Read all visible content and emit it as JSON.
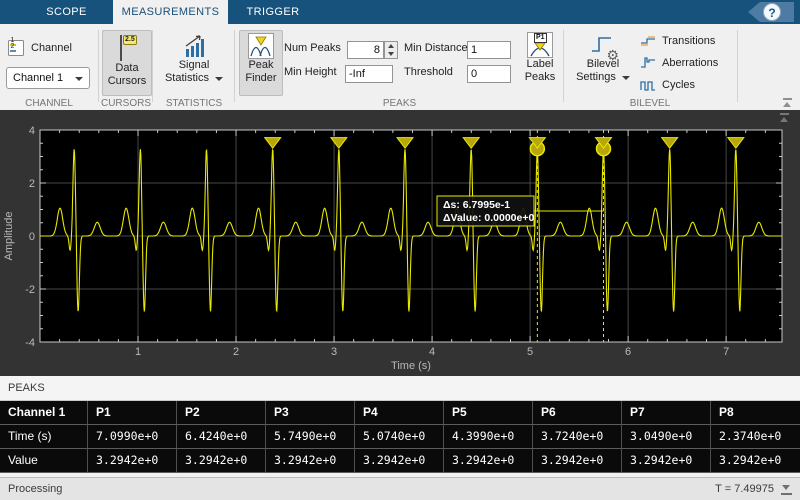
{
  "window": {
    "tabs": [
      {
        "label": "SCOPE"
      },
      {
        "label": "MEASUREMENTS"
      },
      {
        "label": "TRIGGER"
      }
    ],
    "help": "?"
  },
  "ribbon": {
    "channel": {
      "icon_label": "Channel",
      "selected": "Channel 1",
      "digit1": "1",
      "digit2": "2",
      "section": "CHANNEL"
    },
    "cursors": {
      "line1": "Data",
      "line2": "Cursors",
      "badge": "2.5",
      "section": "CURSORS"
    },
    "statistics": {
      "line1": "Signal",
      "line2": "Statistics",
      "section": "STATISTICS"
    },
    "peaks": {
      "finder_line1": "Peak",
      "finder_line2": "Finder",
      "num_peaks_label": "Num Peaks",
      "num_peaks_value": "8",
      "min_distance_label": "Min Distance",
      "min_distance_value": "1",
      "min_height_label": "Min Height",
      "min_height_value": "-Inf",
      "threshold_label": "Threshold",
      "threshold_value": "0",
      "label_line1": "Label",
      "label_line2": "Peaks",
      "p1_badge": "P1",
      "section": "PEAKS"
    },
    "bilevel": {
      "line1": "Bilevel",
      "line2": "Settings",
      "items": [
        {
          "label": "Transitions"
        },
        {
          "label": "Aberrations"
        },
        {
          "label": "Cycles"
        }
      ],
      "section": "BILEVEL"
    },
    "icons": {
      "gear": "⚙"
    }
  },
  "chart_data": {
    "type": "line",
    "title": "",
    "xlabel": "Time (s)",
    "ylabel": "Amplitude",
    "xlim": [
      0,
      7.57
    ],
    "ylim": [
      -4,
      4
    ],
    "xticks": [
      1,
      2,
      3,
      4,
      5,
      6,
      7
    ],
    "yticks": [
      4,
      2,
      0,
      -2,
      -4
    ],
    "grid": true,
    "bg": "#000000",
    "line_color": "#e8e800",
    "marker_fill": "#b8a60b",
    "grid_color": "#474747",
    "signal": {
      "kind": "synthetic-ecg",
      "first_beat": 0.349,
      "period": 0.675,
      "beats": 11,
      "components": [
        {
          "amp": 1.05,
          "center": -0.145,
          "sigma": 0.028
        },
        {
          "amp": -0.55,
          "center": -0.042,
          "sigma": 0.01
        },
        {
          "amp": 3.2942,
          "center": 0.0,
          "sigma": 0.0125
        },
        {
          "amp": -2.87,
          "center": 0.04,
          "sigma": 0.0125
        },
        {
          "amp": 0.52,
          "center": 0.235,
          "sigma": 0.03
        }
      ]
    },
    "peak_markers": {
      "times": [
        2.374,
        3.049,
        3.724,
        4.399,
        5.074,
        5.749,
        6.424,
        7.099
      ],
      "value": 3.2942
    },
    "cursors": {
      "times": [
        5.074,
        5.749
      ],
      "value": 3.2942
    },
    "tooltip": {
      "line1": "Δs: 6.7995e-1",
      "line2": "ΔValue: 0.0000e+0"
    }
  },
  "peaks_panel": {
    "title": "PEAKS",
    "table": {
      "header": [
        "Channel 1",
        "P1",
        "P2",
        "P3",
        "P4",
        "P5",
        "P6",
        "P7",
        "P8"
      ],
      "rows": [
        {
          "label": "Time (s)",
          "values": [
            "7.0990e+0",
            "6.4240e+0",
            "5.7490e+0",
            "5.0740e+0",
            "4.3990e+0",
            "3.7240e+0",
            "3.0490e+0",
            "2.3740e+0"
          ]
        },
        {
          "label": "Value",
          "values": [
            "3.2942e+0",
            "3.2942e+0",
            "3.2942e+0",
            "3.2942e+0",
            "3.2942e+0",
            "3.2942e+0",
            "3.2942e+0",
            "3.2942e+0"
          ]
        }
      ]
    }
  },
  "status": {
    "left": "Processing",
    "right": "T = 7.49975"
  }
}
